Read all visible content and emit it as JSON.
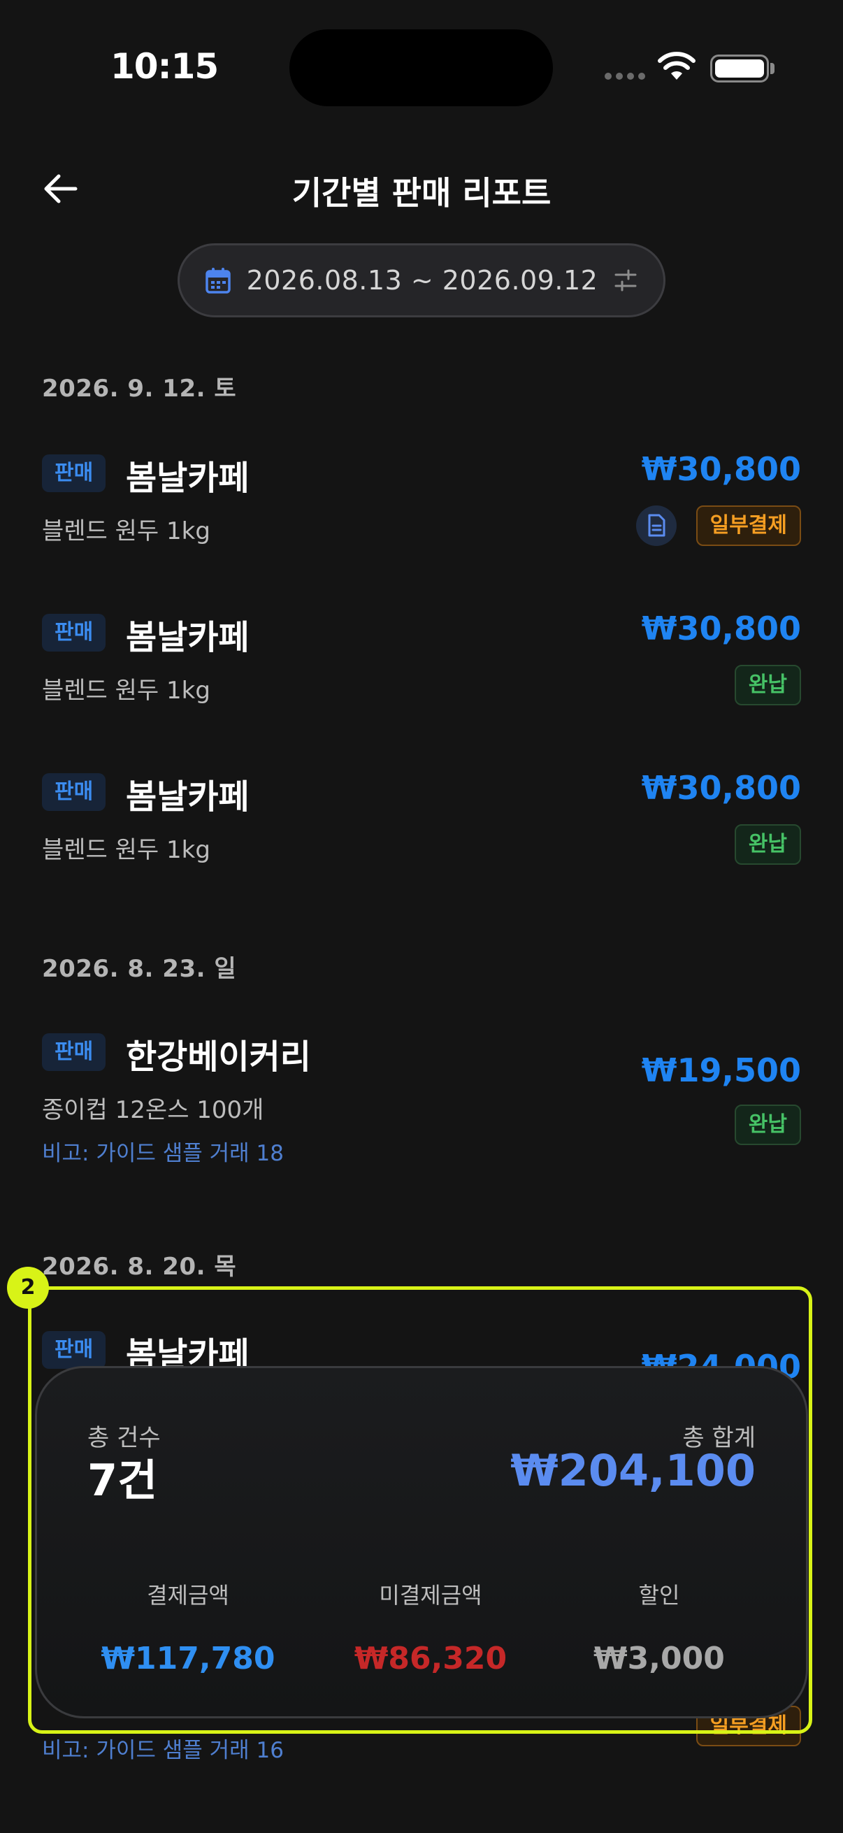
{
  "status": {
    "time": "10:15"
  },
  "header": {
    "title": "기간별 판매 리포트"
  },
  "date_range": {
    "label": "2026.08.13 ~ 2026.09.12"
  },
  "sections": [
    {
      "date": "2026. 9. 12. 토",
      "rows": [
        {
          "tag": "판매",
          "store": "봄날카페",
          "item": "블렌드 원두 1kg",
          "amount": "₩30,800",
          "status": "일부결제"
        },
        {
          "tag": "판매",
          "store": "봄날카페",
          "item": "블렌드 원두 1kg",
          "amount": "₩30,800",
          "status": "완납"
        },
        {
          "tag": "판매",
          "store": "봄날카페",
          "item": "블렌드 원두 1kg",
          "amount": "₩30,800",
          "status": "완납"
        }
      ]
    },
    {
      "date": "2026. 8. 23. 일",
      "rows": [
        {
          "tag": "판매",
          "store": "한강베이커리",
          "item": "종이컵 12온스 100개",
          "memo": "비고: 가이드 샘플 거래 18",
          "amount": "₩19,500",
          "status": "완납"
        }
      ]
    },
    {
      "date": "2026. 8. 20. 목",
      "rows": [
        {
          "tag": "판매",
          "store": "봄날카페",
          "amount": "₩24,000",
          "memo": "비고: 가이드 샘플 거래 16",
          "status": "일부결제"
        }
      ]
    }
  ],
  "summary": {
    "marker": "2",
    "count_label": "총 건수",
    "count": "7건",
    "total_label": "총 합계",
    "total": "₩204,100",
    "paid_label": "결제금액",
    "paid": "₩117,780",
    "unpaid_label": "미결제금액",
    "unpaid": "₩86,320",
    "discount_label": "할인",
    "discount": "₩3,000"
  },
  "colors": {
    "accent": "#1f84f2",
    "paid_status": "#46c266",
    "partial_status": "#f59e22",
    "unpaid": "#c62828",
    "highlight": "#d8f317"
  }
}
